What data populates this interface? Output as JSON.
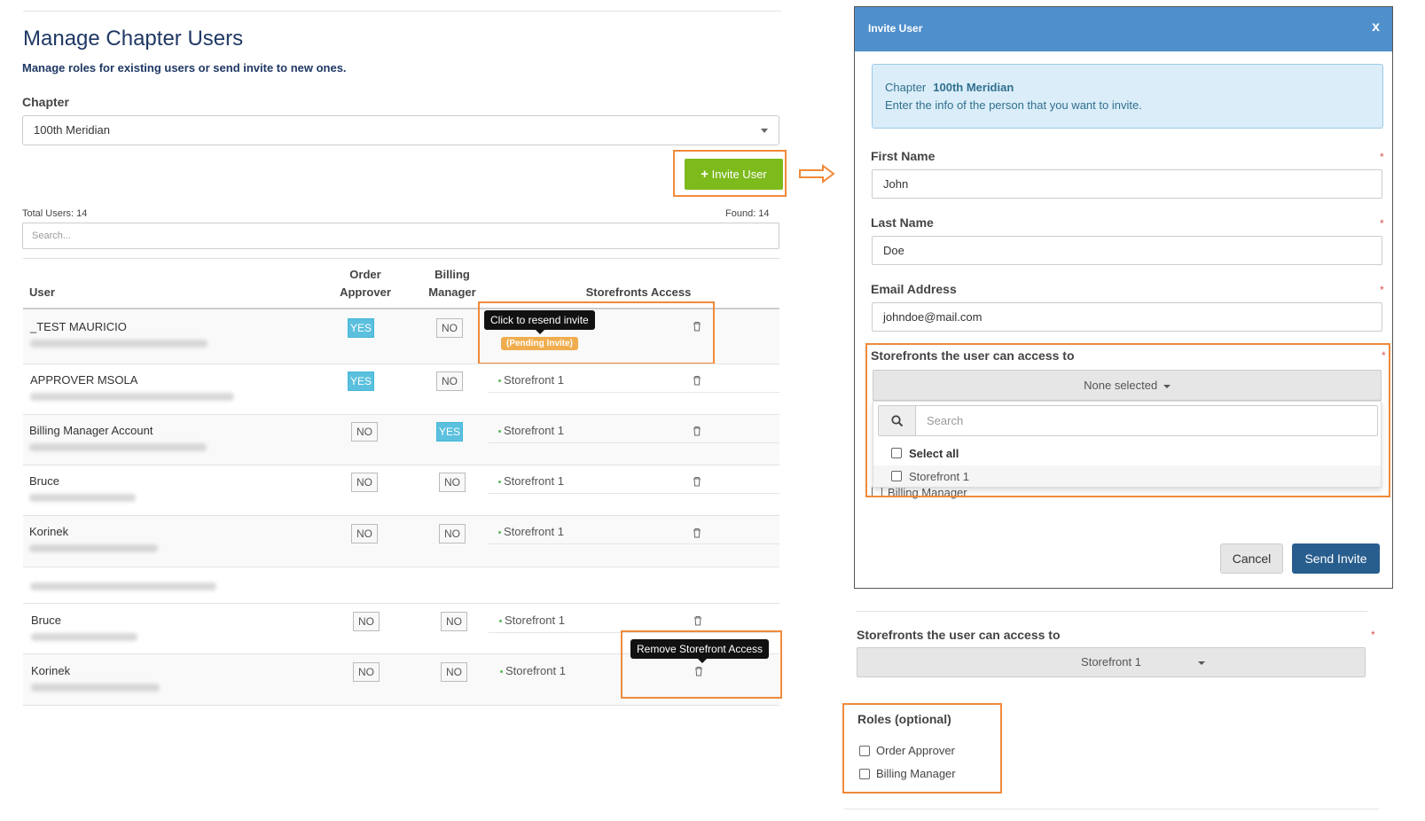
{
  "page": {
    "title": "Manage Chapter Users",
    "subtitle": "Manage roles for existing users or send invite to new ones.",
    "chapter_label": "Chapter",
    "chapter_value": "100th Meridian",
    "invite_button": "Invite User",
    "total_users": "Total Users: 14",
    "found": "Found: 14",
    "search_placeholder": "Search..."
  },
  "table": {
    "headers": {
      "user": "User",
      "order1": "Order",
      "order2": "Approver",
      "billing1": "Billing",
      "billing2": "Manager",
      "storefronts": "Storefronts Access"
    },
    "rows": [
      {
        "name": "_TEST MAURICIO",
        "approver": "YES",
        "billing": "NO",
        "storefront": "",
        "pending": "(Pending Invite)"
      },
      {
        "name": "APPROVER MSOLA",
        "approver": "YES",
        "billing": "NO",
        "storefront": "Storefront 1"
      },
      {
        "name": "Billing Manager Account",
        "approver": "NO",
        "billing": "YES",
        "storefront": "Storefront 1"
      },
      {
        "name": "Bruce",
        "approver": "NO",
        "billing": "NO",
        "storefront": "Storefront 1"
      },
      {
        "name": "Korinek",
        "approver": "NO",
        "billing": "NO",
        "storefront": "Storefront 1"
      },
      {
        "name": "Bruce",
        "approver": "NO",
        "billing": "NO",
        "storefront": "Storefront 1"
      },
      {
        "name": "Korinek",
        "approver": "NO",
        "billing": "NO",
        "storefront": "Storefront 1"
      }
    ],
    "tooltip_resend": "Click to resend invite",
    "tooltip_remove": "Remove Storefront Access"
  },
  "modal": {
    "title": "Invite User",
    "close": "x",
    "chapter_label": "Chapter",
    "chapter_value": "100th Meridian",
    "info_text": "Enter the info of the person that you want to invite.",
    "first_name_label": "First Name",
    "first_name_value": "John",
    "last_name_label": "Last Name",
    "last_name_value": "Doe",
    "email_label": "Email Address",
    "email_value": "johndoe@mail.com",
    "required_mark": "*",
    "storefronts_label": "Storefronts the user can access to",
    "multiselect_value": "None selected",
    "multiselect_search_placeholder": "Search",
    "select_all": "Select all",
    "option_storefront": "Storefront 1",
    "hidden_billing": "Billing Manager",
    "cancel_button": "Cancel",
    "send_button": "Send Invite"
  },
  "below": {
    "storefronts_label": "Storefronts the user can access to",
    "storefront_value": "Storefront 1",
    "roles_label": "Roles (optional)",
    "role_order_approver": "Order Approver",
    "role_billing_manager": "Billing Manager"
  },
  "colors": {
    "accent_orange": "#f08a3a",
    "invite_green": "#7dba1c",
    "modal_header_blue": "#4f8fcc",
    "send_blue": "#285e8e",
    "yes_badge": "#5bc0de",
    "pending_badge": "#f0ad4e"
  }
}
